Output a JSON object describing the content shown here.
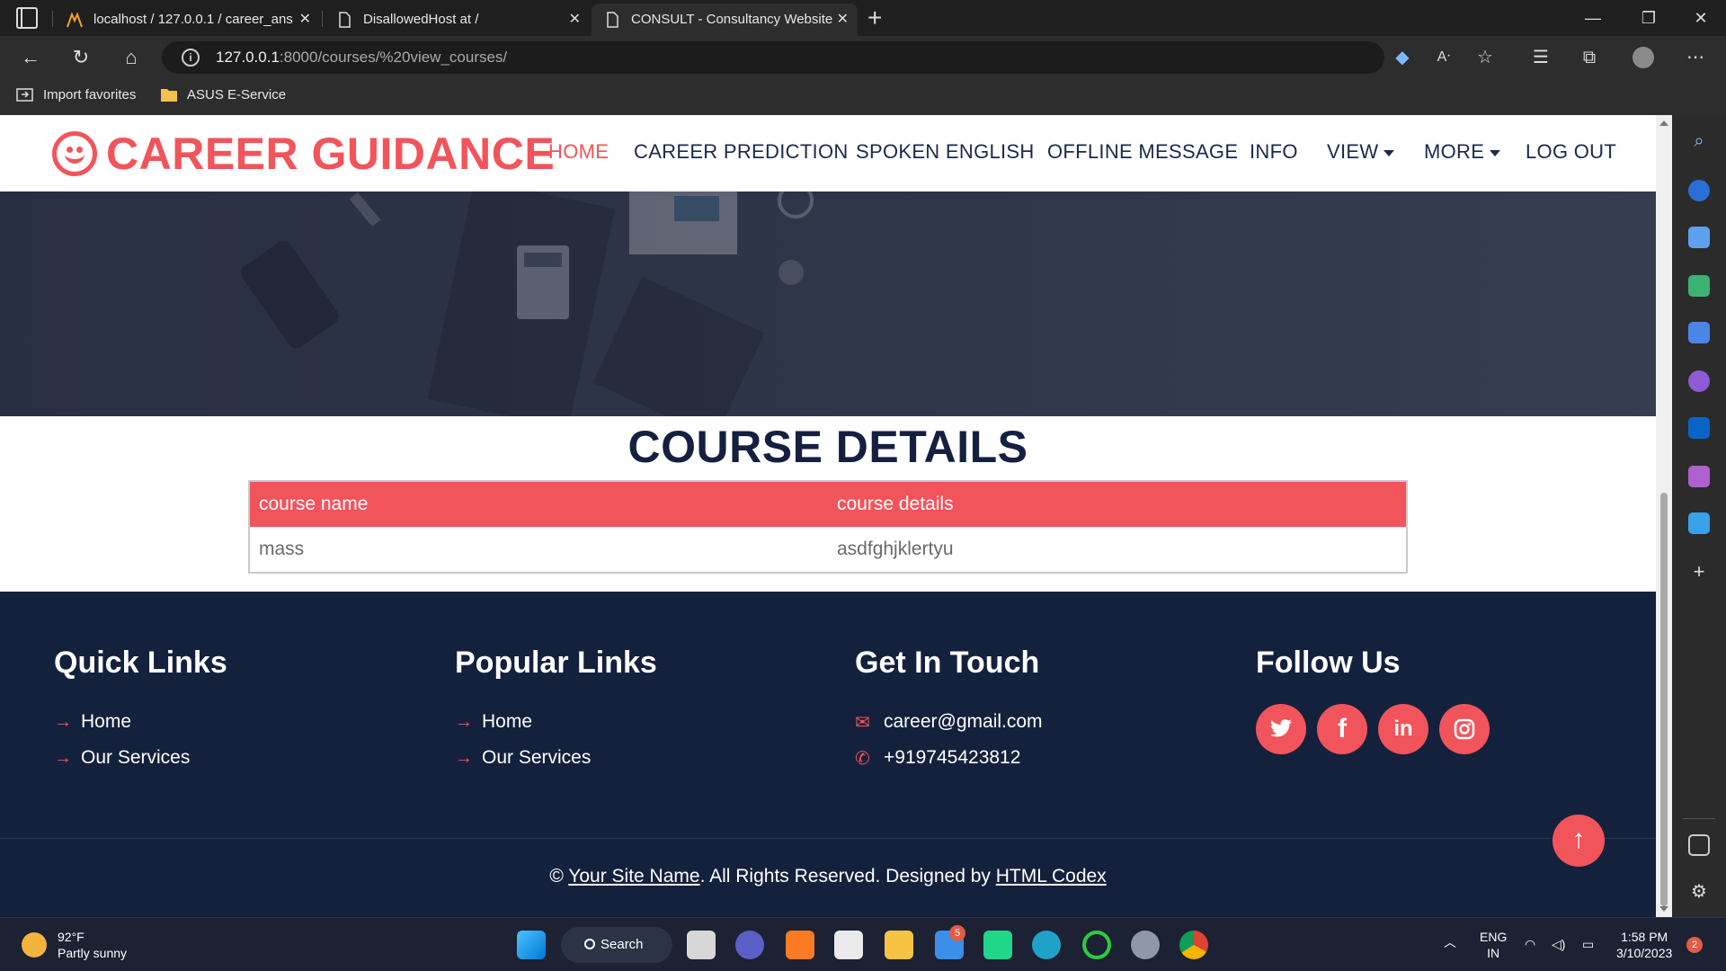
{
  "browser": {
    "tabs": [
      {
        "title": "localhost / 127.0.0.1 / career_ans",
        "active": false
      },
      {
        "title": "DisallowedHost at /",
        "active": false
      },
      {
        "title": "CONSULT - Consultancy Website",
        "active": true
      }
    ],
    "url_host": "127.0.0.1",
    "url_rest": ":8000/courses/%20view_courses/",
    "favorites": [
      "Import favorites",
      "ASUS E-Service"
    ]
  },
  "site": {
    "brand": "CAREER GUIDANCE",
    "accent": "#F2545B",
    "nav": [
      {
        "label": "HOME",
        "active": true
      },
      {
        "label": "CAREER PREDICTION",
        "active": false
      },
      {
        "label": "SPOKEN ENGLISH",
        "active": false
      },
      {
        "label": "OFFLINE MESSAGE",
        "active": false
      },
      {
        "label": "INFO",
        "active": false
      },
      {
        "label": "VIEW",
        "active": false,
        "dropdown": true
      },
      {
        "label": "MORE",
        "active": false,
        "dropdown": true
      },
      {
        "label": "LOG OUT",
        "active": false
      }
    ]
  },
  "course": {
    "title": "COURSE DETAILS",
    "headers": [
      "course name",
      "course details"
    ],
    "rows": [
      [
        "mass",
        "asdfghjklertyu"
      ]
    ]
  },
  "footer": {
    "quick_links": {
      "title": "Quick Links",
      "items": [
        "Home",
        "Our Services"
      ]
    },
    "popular_links": {
      "title": "Popular Links",
      "items": [
        "Home",
        "Our Services"
      ]
    },
    "contact": {
      "title": "Get In Touch",
      "email": "career@gmail.com",
      "phone": "+919745423812"
    },
    "follow": {
      "title": "Follow Us",
      "icons": [
        "twitter-icon",
        "facebook-icon",
        "linkedin-icon",
        "instagram-icon"
      ]
    },
    "copyright_prefix": "©",
    "site_name": "Your Site Name",
    "rights": ". All Rights Reserved. Designed by",
    "designer": "HTML Codex"
  },
  "taskbar": {
    "weather_temp": "92°F",
    "weather_desc": "Partly sunny",
    "search_label": "Search",
    "mail_badge": "5",
    "lang_top": "ENG",
    "lang_bottom": "IN",
    "time": "1:58 PM",
    "date": "3/10/2023",
    "notification_count": "2"
  }
}
